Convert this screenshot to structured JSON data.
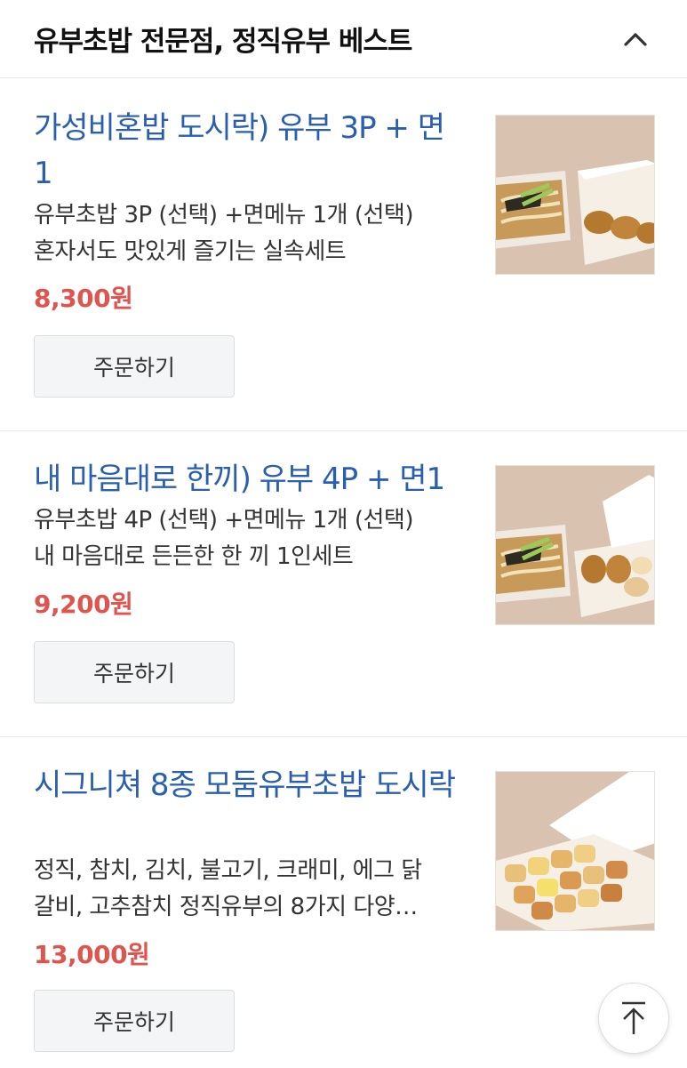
{
  "section": {
    "title": "유부초밥 전문점, 정직유부 베스트",
    "collapse_icon": "chevron-up-icon"
  },
  "items": [
    {
      "title": "가성비혼밥 도시락) 유부 3P + 면 1",
      "desc_lines": [
        "유부초밥 3P (선택) +면메뉴 1개 (선택)",
        "혼자서도 맛있게 즐기는 실속세트"
      ],
      "price": "8,300원",
      "button": "주문하기",
      "image": "udon-with-3-yubu-box"
    },
    {
      "title": "내 마음대로 한끼) 유부 4P + 면1",
      "desc_lines": [
        "유부초밥 4P (선택) +면메뉴 1개 (선택)",
        "내 마음대로 든든한 한 끼 1인세트"
      ],
      "price": "9,200원",
      "button": "주문하기",
      "image": "udon-with-4-yubu-box"
    },
    {
      "title": "시그니쳐 8종 모둠유부초밥 도시락",
      "desc_lines": [
        "정직, 참치, 김치, 불고기, 크래미, 에그 닭",
        "갈비, 고추참치 정직유부의 8가지 다양…"
      ],
      "price": "13,000원",
      "button": "주문하기",
      "image": "assorted-8-yubu-box"
    }
  ],
  "colors": {
    "title_blue": "#2a5fb0",
    "price_red": "#e0544e"
  },
  "scroll_top_icon": "arrow-up-icon"
}
